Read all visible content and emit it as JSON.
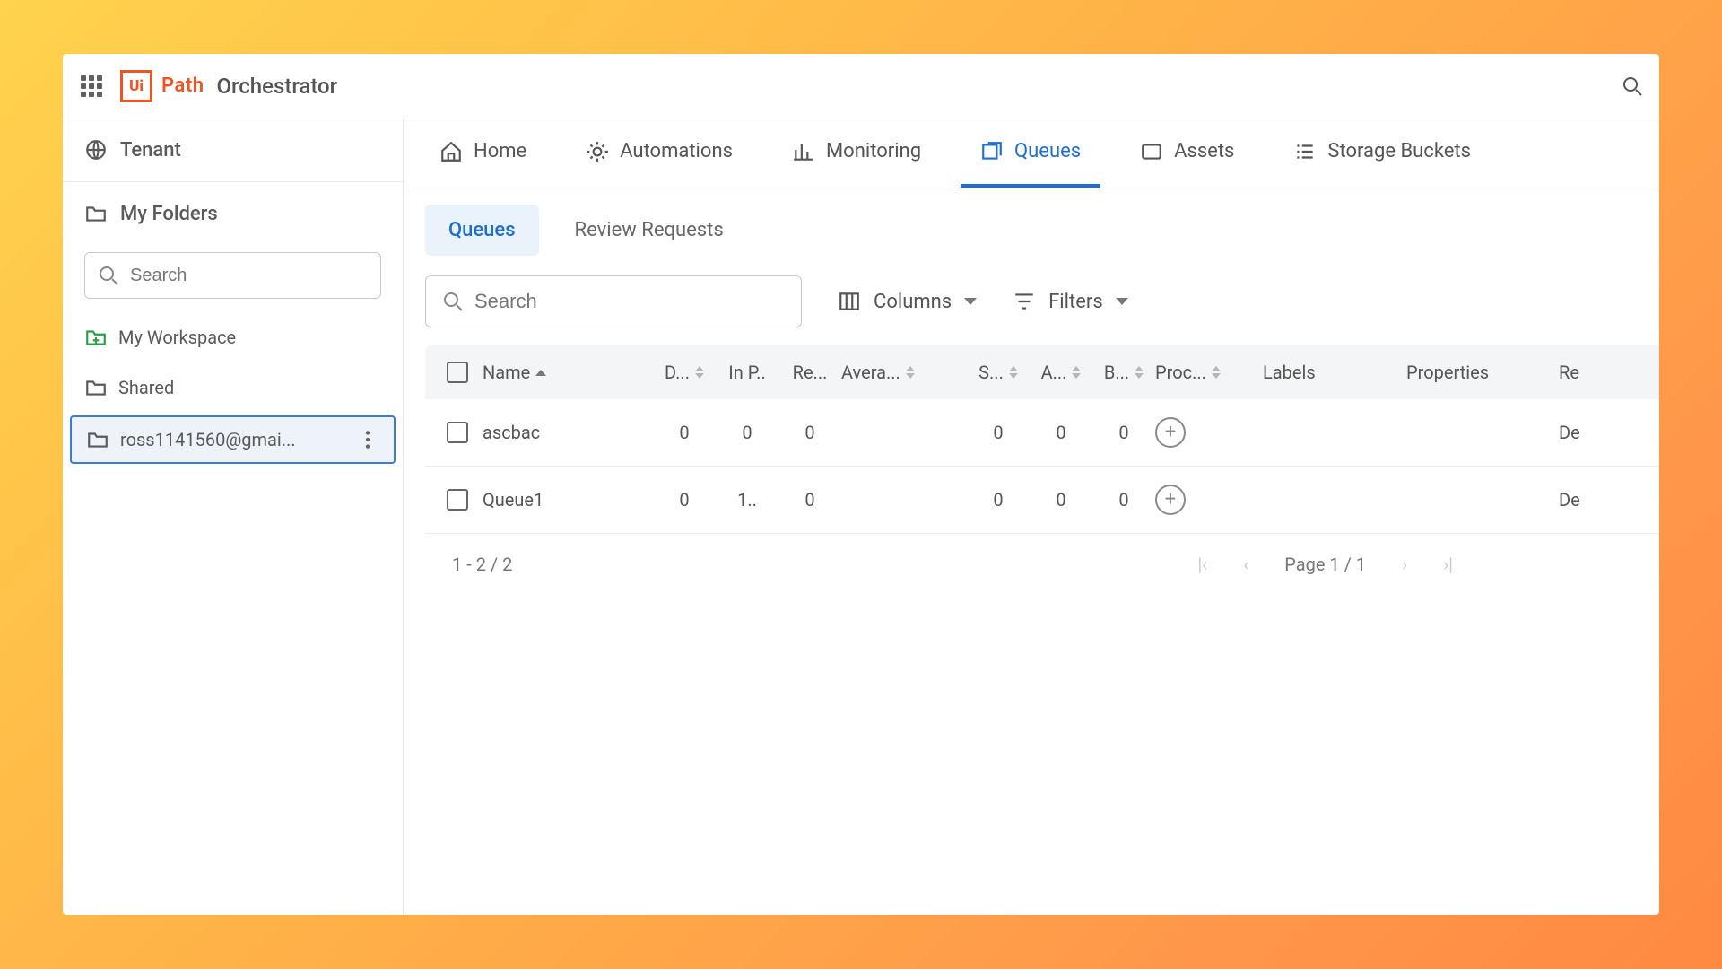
{
  "app": {
    "brand": "Path",
    "title": "Orchestrator"
  },
  "sidebar": {
    "tenant_label": "Tenant",
    "my_folders_label": "My Folders",
    "search_placeholder": "Search",
    "items": [
      {
        "label": "My Workspace"
      },
      {
        "label": "Shared"
      },
      {
        "label": "ross1141560@gmai..."
      }
    ]
  },
  "nav": {
    "tabs": [
      {
        "label": "Home"
      },
      {
        "label": "Automations"
      },
      {
        "label": "Monitoring"
      },
      {
        "label": "Queues"
      },
      {
        "label": "Assets"
      },
      {
        "label": "Storage Buckets"
      }
    ]
  },
  "subtabs": {
    "queues": "Queues",
    "review": "Review Requests"
  },
  "toolbar": {
    "search_placeholder": "Search",
    "columns": "Columns",
    "filters": "Filters"
  },
  "table": {
    "headers": {
      "name": "Name",
      "d": "D...",
      "inp": "In P..",
      "re": "Re...",
      "avg": "Avera...",
      "s": "S...",
      "a": "A...",
      "b": "B...",
      "proc": "Proc...",
      "labels": "Labels",
      "props": "Properties",
      "re2": "Re"
    },
    "rows": [
      {
        "name": "ascbac",
        "d": "0",
        "inp": "0",
        "re": "0",
        "avg": "",
        "s": "0",
        "a": "0",
        "b": "0",
        "re2": "De"
      },
      {
        "name": "Queue1",
        "d": "0",
        "inp": "1..",
        "re": "0",
        "avg": "",
        "s": "0",
        "a": "0",
        "b": "0",
        "re2": "De"
      }
    ]
  },
  "pager": {
    "range": "1 - 2 / 2",
    "page": "Page 1 / 1"
  }
}
